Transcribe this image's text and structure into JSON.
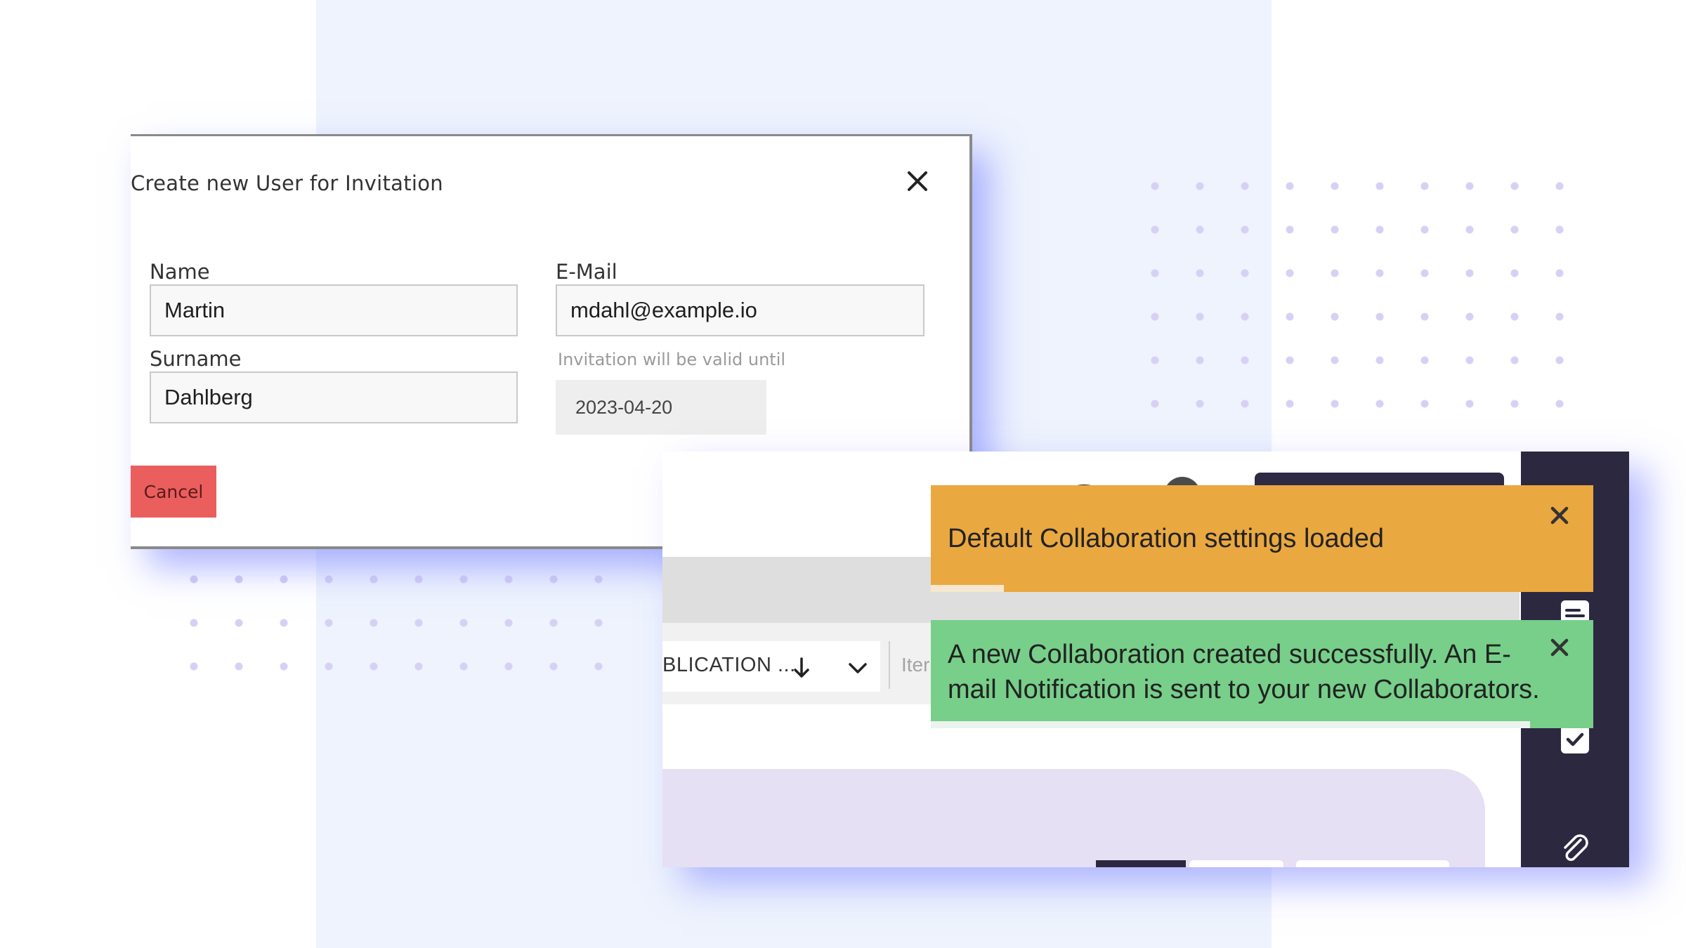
{
  "dialog": {
    "title": "Create new User for Invitation",
    "name_label": "Name",
    "name_value": "Martin",
    "email_label": "E-Mail",
    "email_value": "mdahl@example.io",
    "surname_label": "Surname",
    "surname_value": "Dahlberg",
    "validity_hint": "Invitation will be valid until",
    "valid_until": "2023-04-20",
    "cancel_label": "Cancel"
  },
  "app": {
    "sort_label": "BLICATION ...",
    "items_label": "Iter",
    "icons": {
      "sort_arrow": "arrow-down-icon",
      "dropdown": "chevron-down-icon",
      "attachment": "paperclip-icon",
      "checkbox": "check-icon",
      "notes": "document-icon"
    }
  },
  "toasts": [
    {
      "message": "Default Collaboration settings loaded",
      "color": "#e9a840",
      "progress": 0.11
    },
    {
      "message": "A new Collaboration created successfully. An E-mail Notification is sent to your new Collaborators.",
      "color": "#77cf8a",
      "progress": 0.905
    }
  ],
  "colors": {
    "cancel": "#ea5e5e",
    "sidebar": "#2c2840",
    "accent_shadow": "#6e78ff"
  }
}
